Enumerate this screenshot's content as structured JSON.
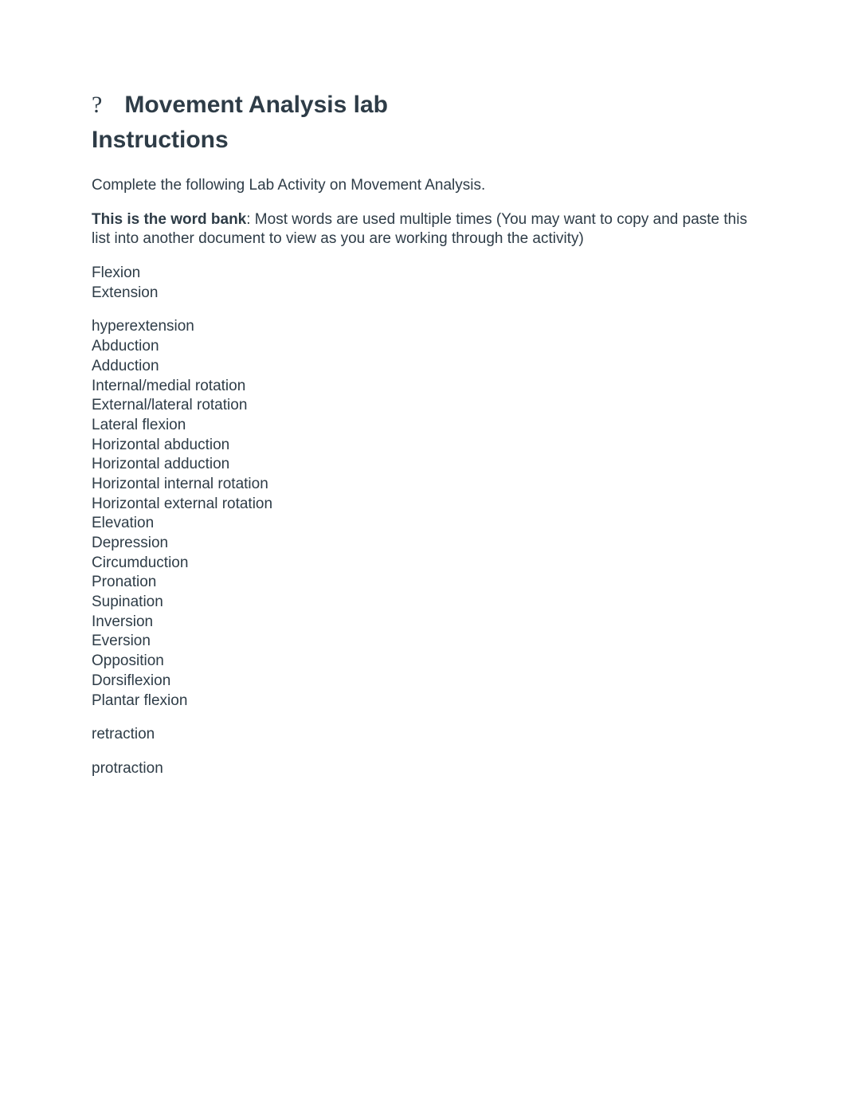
{
  "header": {
    "icon_label": "?",
    "title": "Movement Analysis lab"
  },
  "instructions_heading": "Instructions",
  "intro_para": "Complete the following Lab Activity on Movement Analysis.",
  "word_bank_intro": {
    "bold": "This is the word bank",
    "rest": ": Most words are used multiple times (You may want to copy and paste this list into another document to view as you are working through the activity)"
  },
  "word_groups": [
    [
      "Flexion",
      "Extension"
    ],
    [
      "hyperextension",
      "Abduction",
      "Adduction",
      "Internal/medial rotation",
      "External/lateral rotation",
      "Lateral flexion",
      "Horizontal abduction",
      "Horizontal adduction",
      "Horizontal internal rotation",
      "Horizontal external rotation",
      "Elevation",
      "Depression",
      "Circumduction",
      "Pronation",
      "Supination",
      "Inversion",
      "Eversion",
      "Opposition",
      "Dorsiflexion",
      "Plantar flexion"
    ],
    [
      "retraction"
    ],
    [
      "protraction"
    ]
  ]
}
